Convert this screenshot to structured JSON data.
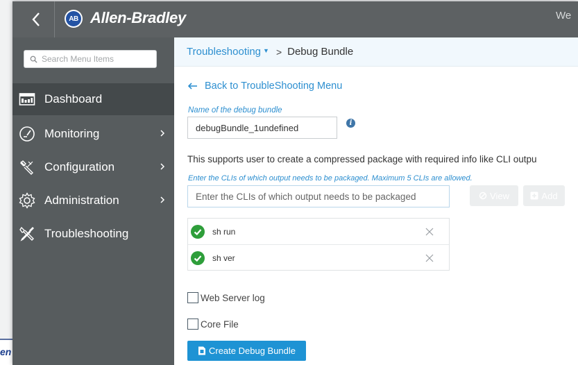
{
  "header": {
    "logo_badge": "AB",
    "brand": "Allen-Bradley",
    "welcome": "We"
  },
  "background": {
    "fragment_text": "en"
  },
  "sidebar": {
    "search_placeholder": "Search Menu Items",
    "items": [
      {
        "label": "Dashboard",
        "icon": "dashboard-icon",
        "active": true,
        "has_children": false
      },
      {
        "label": "Monitoring",
        "icon": "gauge-icon",
        "active": false,
        "has_children": true
      },
      {
        "label": "Configuration",
        "icon": "wrench-icon",
        "active": false,
        "has_children": true
      },
      {
        "label": "Administration",
        "icon": "gear-icon",
        "active": false,
        "has_children": true
      },
      {
        "label": "Troubleshooting",
        "icon": "tools-icon",
        "active": false,
        "has_children": false
      }
    ]
  },
  "breadcrumb": {
    "parent": "Troubleshooting",
    "separator": ">",
    "current": "Debug Bundle"
  },
  "main": {
    "back_link": "Back to TroubleShooting Menu",
    "name_label": "Name of the debug bundle",
    "name_value": "debugBundle_1undefined",
    "description": "This supports user to create a compressed package with required info like CLI outpu",
    "cli_hint": "Enter the CLIs of which output needs to be packaged. Maximum 5 CLIs are allowed.",
    "cli_placeholder": "Enter the CLIs of which output needs to be packaged",
    "view_label": "View",
    "add_label": "Add",
    "cli_list": [
      "sh run",
      "sh ver"
    ],
    "web_server_log_label": "Web Server log",
    "core_file_label": "Core File",
    "create_label": "Create Debug Bundle"
  },
  "colors": {
    "topbar": "#5d6163",
    "sidebar": "#575c5e",
    "accent": "#2d8fd0",
    "success": "#2e9e3a"
  }
}
